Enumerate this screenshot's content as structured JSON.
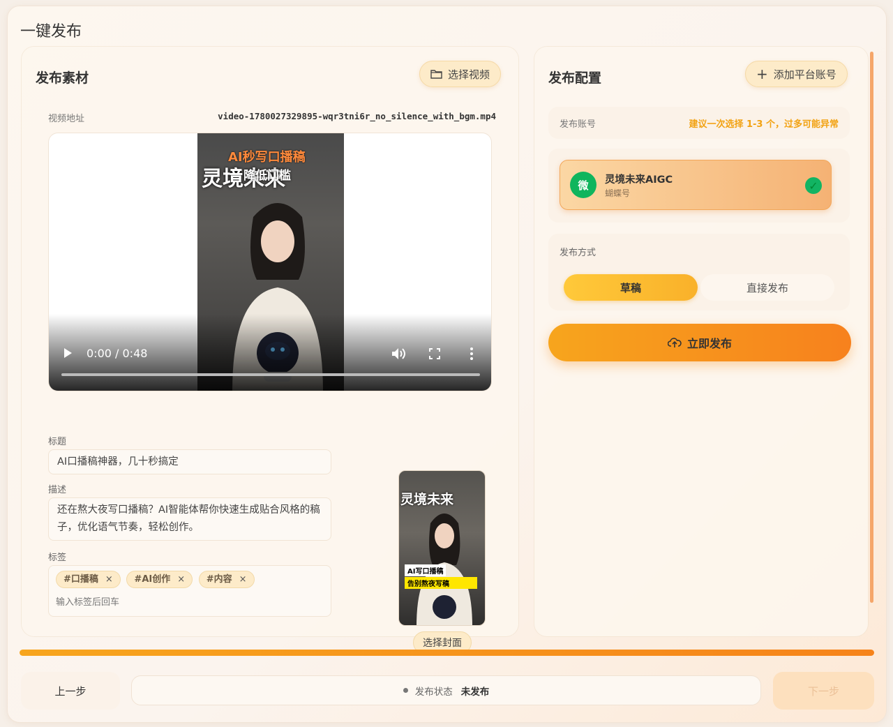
{
  "window": {
    "title": "一键发布"
  },
  "left": {
    "title": "发布素材",
    "select_video_label": "选择视频",
    "source_label": "视频地址",
    "source_value": "video-1780027329895-wqr3tni6r_no_silence_with_bgm.mp4",
    "video": {
      "caption_top": "AI秒写口播稿",
      "caption_big": "灵境未来",
      "caption_sub": "降低门槛",
      "time": "0:00 / 0:48",
      "progress": 0
    },
    "title_label": "标题",
    "title_value": "AI口播稿神器，几十秒搞定",
    "desc_label": "描述",
    "desc_value": "还在熬大夜写口播稿？AI智能体帮你快速生成贴合风格的稿子，优化语气节奏，轻松创作。",
    "tags_label": "标签",
    "tags": [
      {
        "text": "#口播稿"
      },
      {
        "text": "#AI创作"
      },
      {
        "text": "#内容"
      }
    ],
    "tag_remove_glyph": "×",
    "tag_placeholder": "输入标签后回车",
    "cover": {
      "caption_big": "灵境未来",
      "bar1": "AI写口播稿",
      "bar2": "告别熬夜写稿"
    },
    "select_cover_label": "选择封面"
  },
  "right": {
    "title": "发布配置",
    "add_account_label": "添加平台账号",
    "account_label": "发布账号",
    "account_hint": "建议一次选择 1-3 个，过多可能异常",
    "account": {
      "avatar": "微",
      "name": "灵境未来AIGC",
      "platform": "蝴蝶号",
      "check": "✓",
      "avatar_color": "#0fb55d"
    },
    "mode_label": "发布方式",
    "modes": [
      "草稿",
      "直接发布"
    ],
    "publish_label": "立即发布"
  },
  "footer": {
    "progress": 100,
    "prev_label": "上一步",
    "status_label": "发布状态",
    "status_value": "未发布",
    "next_label": "下一步"
  },
  "colors": {
    "accent": "#f7a51d",
    "accent_dark": "#f6831a",
    "warning_text": "#f2a212"
  }
}
